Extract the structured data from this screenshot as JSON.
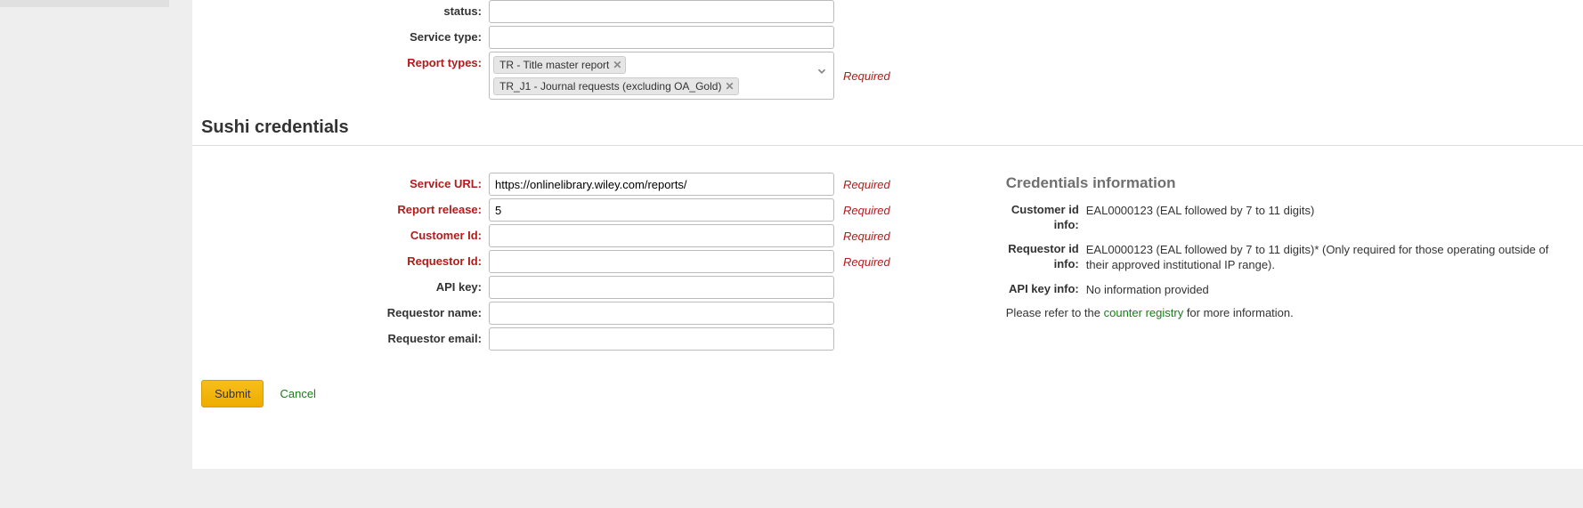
{
  "top": {
    "status_label": "status:",
    "service_type_label": "Service type:",
    "report_types_label": "Report types:",
    "report_types_required": "Required",
    "report_tags": [
      "TR - Title master report",
      "TR_J1 - Journal requests (excluding OA_Gold)"
    ]
  },
  "section_heading": "Sushi credentials",
  "fields": {
    "service_url": {
      "label": "Service URL:",
      "value": "https://onlinelibrary.wiley.com/reports/",
      "required": "Required"
    },
    "report_release": {
      "label": "Report release:",
      "value": "5",
      "required": "Required"
    },
    "customer_id": {
      "label": "Customer Id:",
      "value": "",
      "required": "Required"
    },
    "requestor_id": {
      "label": "Requestor Id:",
      "value": "",
      "required": "Required"
    },
    "api_key": {
      "label": "API key:",
      "value": ""
    },
    "requestor_name": {
      "label": "Requestor name:",
      "value": ""
    },
    "requestor_email": {
      "label": "Requestor email:",
      "value": ""
    }
  },
  "info": {
    "title": "Credentials information",
    "customer_id_label": "Customer id info:",
    "customer_id_info": "EAL0000123 (EAL followed by 7 to 11 digits)",
    "requestor_id_label": "Requestor id info:",
    "requestor_id_info": "EAL0000123 (EAL followed by 7 to 11 digits)* (Only required for those operating outside of their approved institutional IP range).",
    "api_key_label": "API key info:",
    "api_key_info": "No information provided",
    "note_prefix": "Please refer to the ",
    "registry_link": "counter registry",
    "note_suffix": " for more information."
  },
  "actions": {
    "submit": "Submit",
    "cancel": "Cancel"
  }
}
